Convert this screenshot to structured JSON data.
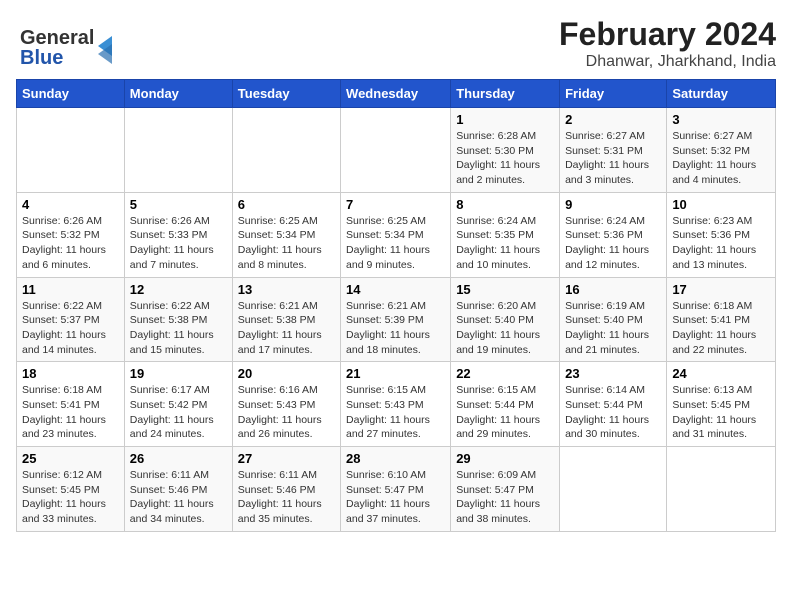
{
  "logo": {
    "line1": "General",
    "line2": "Blue"
  },
  "title": "February 2024",
  "location": "Dhanwar, Jharkhand, India",
  "days_of_week": [
    "Sunday",
    "Monday",
    "Tuesday",
    "Wednesday",
    "Thursday",
    "Friday",
    "Saturday"
  ],
  "weeks": [
    [
      {
        "day": null
      },
      {
        "day": null
      },
      {
        "day": null
      },
      {
        "day": null
      },
      {
        "day": 1,
        "sunrise": "Sunrise: 6:28 AM",
        "sunset": "Sunset: 5:30 PM",
        "daylight": "Daylight: 11 hours and 2 minutes."
      },
      {
        "day": 2,
        "sunrise": "Sunrise: 6:27 AM",
        "sunset": "Sunset: 5:31 PM",
        "daylight": "Daylight: 11 hours and 3 minutes."
      },
      {
        "day": 3,
        "sunrise": "Sunrise: 6:27 AM",
        "sunset": "Sunset: 5:32 PM",
        "daylight": "Daylight: 11 hours and 4 minutes."
      }
    ],
    [
      {
        "day": 4,
        "sunrise": "Sunrise: 6:26 AM",
        "sunset": "Sunset: 5:32 PM",
        "daylight": "Daylight: 11 hours and 6 minutes."
      },
      {
        "day": 5,
        "sunrise": "Sunrise: 6:26 AM",
        "sunset": "Sunset: 5:33 PM",
        "daylight": "Daylight: 11 hours and 7 minutes."
      },
      {
        "day": 6,
        "sunrise": "Sunrise: 6:25 AM",
        "sunset": "Sunset: 5:34 PM",
        "daylight": "Daylight: 11 hours and 8 minutes."
      },
      {
        "day": 7,
        "sunrise": "Sunrise: 6:25 AM",
        "sunset": "Sunset: 5:34 PM",
        "daylight": "Daylight: 11 hours and 9 minutes."
      },
      {
        "day": 8,
        "sunrise": "Sunrise: 6:24 AM",
        "sunset": "Sunset: 5:35 PM",
        "daylight": "Daylight: 11 hours and 10 minutes."
      },
      {
        "day": 9,
        "sunrise": "Sunrise: 6:24 AM",
        "sunset": "Sunset: 5:36 PM",
        "daylight": "Daylight: 11 hours and 12 minutes."
      },
      {
        "day": 10,
        "sunrise": "Sunrise: 6:23 AM",
        "sunset": "Sunset: 5:36 PM",
        "daylight": "Daylight: 11 hours and 13 minutes."
      }
    ],
    [
      {
        "day": 11,
        "sunrise": "Sunrise: 6:22 AM",
        "sunset": "Sunset: 5:37 PM",
        "daylight": "Daylight: 11 hours and 14 minutes."
      },
      {
        "day": 12,
        "sunrise": "Sunrise: 6:22 AM",
        "sunset": "Sunset: 5:38 PM",
        "daylight": "Daylight: 11 hours and 15 minutes."
      },
      {
        "day": 13,
        "sunrise": "Sunrise: 6:21 AM",
        "sunset": "Sunset: 5:38 PM",
        "daylight": "Daylight: 11 hours and 17 minutes."
      },
      {
        "day": 14,
        "sunrise": "Sunrise: 6:21 AM",
        "sunset": "Sunset: 5:39 PM",
        "daylight": "Daylight: 11 hours and 18 minutes."
      },
      {
        "day": 15,
        "sunrise": "Sunrise: 6:20 AM",
        "sunset": "Sunset: 5:40 PM",
        "daylight": "Daylight: 11 hours and 19 minutes."
      },
      {
        "day": 16,
        "sunrise": "Sunrise: 6:19 AM",
        "sunset": "Sunset: 5:40 PM",
        "daylight": "Daylight: 11 hours and 21 minutes."
      },
      {
        "day": 17,
        "sunrise": "Sunrise: 6:18 AM",
        "sunset": "Sunset: 5:41 PM",
        "daylight": "Daylight: 11 hours and 22 minutes."
      }
    ],
    [
      {
        "day": 18,
        "sunrise": "Sunrise: 6:18 AM",
        "sunset": "Sunset: 5:41 PM",
        "daylight": "Daylight: 11 hours and 23 minutes."
      },
      {
        "day": 19,
        "sunrise": "Sunrise: 6:17 AM",
        "sunset": "Sunset: 5:42 PM",
        "daylight": "Daylight: 11 hours and 24 minutes."
      },
      {
        "day": 20,
        "sunrise": "Sunrise: 6:16 AM",
        "sunset": "Sunset: 5:43 PM",
        "daylight": "Daylight: 11 hours and 26 minutes."
      },
      {
        "day": 21,
        "sunrise": "Sunrise: 6:15 AM",
        "sunset": "Sunset: 5:43 PM",
        "daylight": "Daylight: 11 hours and 27 minutes."
      },
      {
        "day": 22,
        "sunrise": "Sunrise: 6:15 AM",
        "sunset": "Sunset: 5:44 PM",
        "daylight": "Daylight: 11 hours and 29 minutes."
      },
      {
        "day": 23,
        "sunrise": "Sunrise: 6:14 AM",
        "sunset": "Sunset: 5:44 PM",
        "daylight": "Daylight: 11 hours and 30 minutes."
      },
      {
        "day": 24,
        "sunrise": "Sunrise: 6:13 AM",
        "sunset": "Sunset: 5:45 PM",
        "daylight": "Daylight: 11 hours and 31 minutes."
      }
    ],
    [
      {
        "day": 25,
        "sunrise": "Sunrise: 6:12 AM",
        "sunset": "Sunset: 5:45 PM",
        "daylight": "Daylight: 11 hours and 33 minutes."
      },
      {
        "day": 26,
        "sunrise": "Sunrise: 6:11 AM",
        "sunset": "Sunset: 5:46 PM",
        "daylight": "Daylight: 11 hours and 34 minutes."
      },
      {
        "day": 27,
        "sunrise": "Sunrise: 6:11 AM",
        "sunset": "Sunset: 5:46 PM",
        "daylight": "Daylight: 11 hours and 35 minutes."
      },
      {
        "day": 28,
        "sunrise": "Sunrise: 6:10 AM",
        "sunset": "Sunset: 5:47 PM",
        "daylight": "Daylight: 11 hours and 37 minutes."
      },
      {
        "day": 29,
        "sunrise": "Sunrise: 6:09 AM",
        "sunset": "Sunset: 5:47 PM",
        "daylight": "Daylight: 11 hours and 38 minutes."
      },
      {
        "day": null
      },
      {
        "day": null
      }
    ]
  ]
}
